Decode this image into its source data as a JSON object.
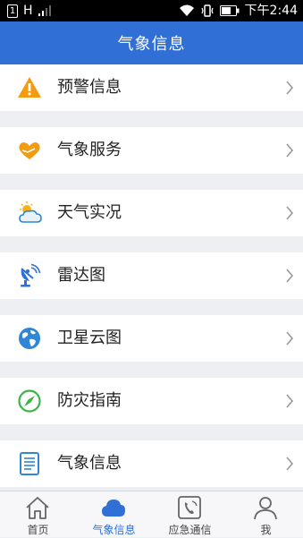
{
  "status_bar": {
    "sim": "1",
    "network": "H",
    "time": "下午2:44"
  },
  "header": {
    "title": "气象信息"
  },
  "menu": {
    "items": [
      {
        "label": "预警信息",
        "icon": "warning-icon"
      },
      {
        "label": "气象服务",
        "icon": "heart-hands-icon"
      },
      {
        "label": "天气实况",
        "icon": "sun-cloud-icon"
      },
      {
        "label": "雷达图",
        "icon": "radar-dish-icon"
      },
      {
        "label": "卫星云图",
        "icon": "globe-icon"
      },
      {
        "label": "防灾指南",
        "icon": "compass-icon"
      },
      {
        "label": "气象信息",
        "icon": "document-icon"
      }
    ]
  },
  "tabs": [
    {
      "label": "首页",
      "icon": "home-icon",
      "active": false
    },
    {
      "label": "气象信息",
      "icon": "cloud-icon",
      "active": true
    },
    {
      "label": "应急通信",
      "icon": "phone-icon",
      "active": false
    },
    {
      "label": "我",
      "icon": "person-icon",
      "active": false
    }
  ],
  "colors": {
    "primary": "#2f6fd6",
    "warning": "#f39c12",
    "green": "#3cb44a",
    "background": "#eeeff3"
  }
}
